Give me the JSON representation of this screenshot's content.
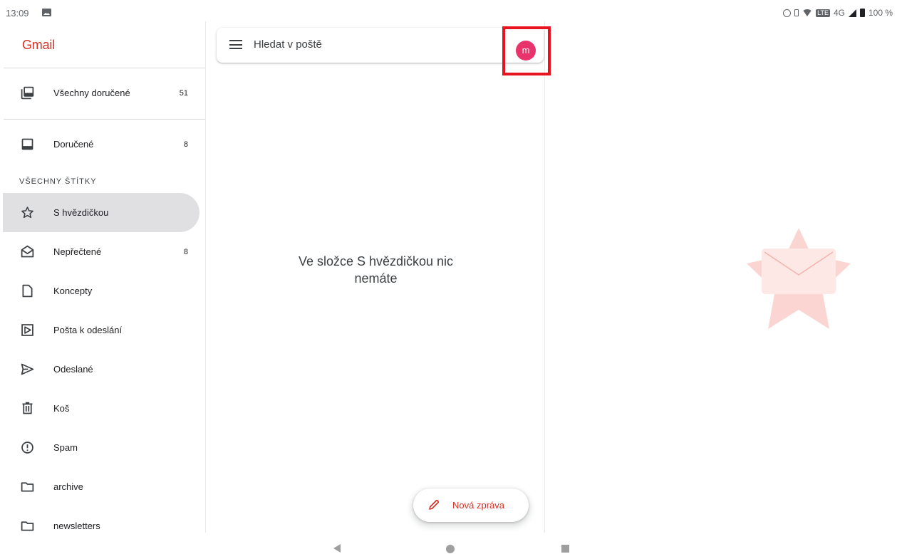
{
  "status_bar": {
    "time": "13:09",
    "network": "4G",
    "lte_badge": "LTE",
    "battery": "100 %"
  },
  "drawer": {
    "app_name": "Gmail",
    "top_items": [
      {
        "label": "Všechny doručené",
        "count": "51",
        "icon": "all-inboxes-icon"
      }
    ],
    "inbox_items": [
      {
        "label": "Doručené",
        "count": "8",
        "icon": "inbox-icon"
      }
    ],
    "section_title": "VŠECHNY ŠTÍTKY",
    "label_items": [
      {
        "label": "S hvězdičkou",
        "count": "",
        "icon": "star-icon",
        "selected": true
      },
      {
        "label": "Nepřečtené",
        "count": "8",
        "icon": "unread-mail-icon"
      },
      {
        "label": "Koncepty",
        "count": "",
        "icon": "draft-icon"
      },
      {
        "label": "Pošta k odeslání",
        "count": "",
        "icon": "outbox-icon"
      },
      {
        "label": "Odeslané",
        "count": "",
        "icon": "send-icon"
      },
      {
        "label": "Koš",
        "count": "",
        "icon": "trash-icon"
      },
      {
        "label": "Spam",
        "count": "",
        "icon": "spam-icon"
      },
      {
        "label": "archive",
        "count": "",
        "icon": "folder-icon"
      },
      {
        "label": "newsletters",
        "count": "",
        "icon": "folder-icon"
      }
    ]
  },
  "search": {
    "placeholder": "Hledat v poště",
    "avatar_letter": "m"
  },
  "main": {
    "empty_line1": "Ve složce S hvězdičkou nic",
    "empty_line2": "nemáte"
  },
  "compose": {
    "label": "Nová zpráva"
  },
  "colors": {
    "brand": "#d93025",
    "avatar": "#e8336b",
    "highlight_frame": "#e8131f",
    "selected_bg": "#e0e0e3"
  }
}
